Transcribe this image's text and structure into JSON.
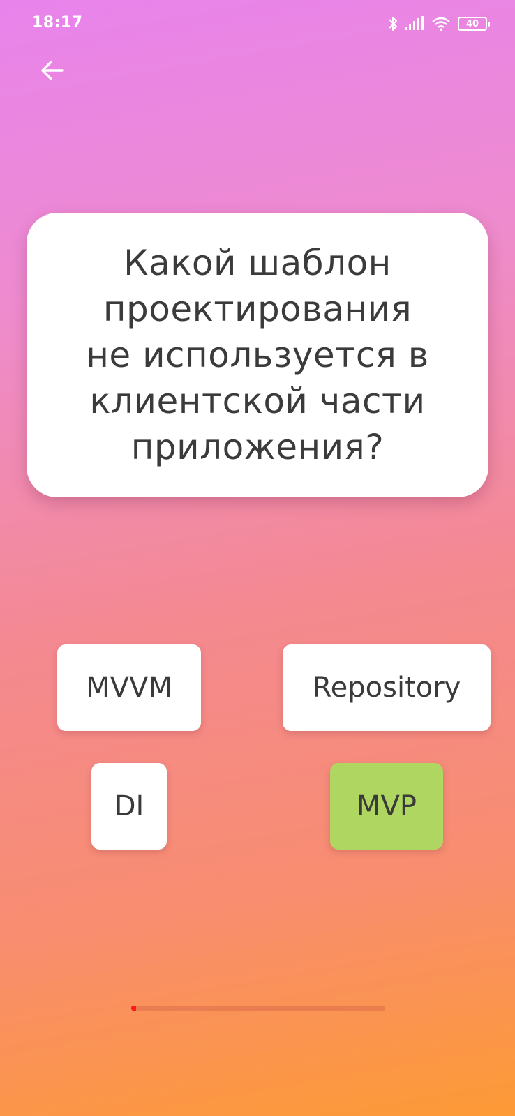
{
  "status_bar": {
    "time": "18:17",
    "battery": "40",
    "icons": [
      "bluetooth-icon",
      "signal-icon",
      "wifi-icon",
      "battery-icon"
    ]
  },
  "header": {
    "back_icon": "arrow-left-icon"
  },
  "question": {
    "text": "Какой шаблон проектирования не используется в клиентской части приложения?"
  },
  "answers": [
    {
      "label": "MVVM",
      "selected": false
    },
    {
      "label": "Repository",
      "selected": false
    },
    {
      "label": "DI",
      "selected": false
    },
    {
      "label": "MVP",
      "selected": true
    }
  ],
  "progress": {
    "fraction": 0.02
  },
  "colors": {
    "gradient_top": "#e883ec",
    "gradient_bottom": "#fd9a35",
    "selected_answer": "#aed660",
    "progress_fill": "#ff1a1a",
    "text": "#3a3a3a"
  }
}
